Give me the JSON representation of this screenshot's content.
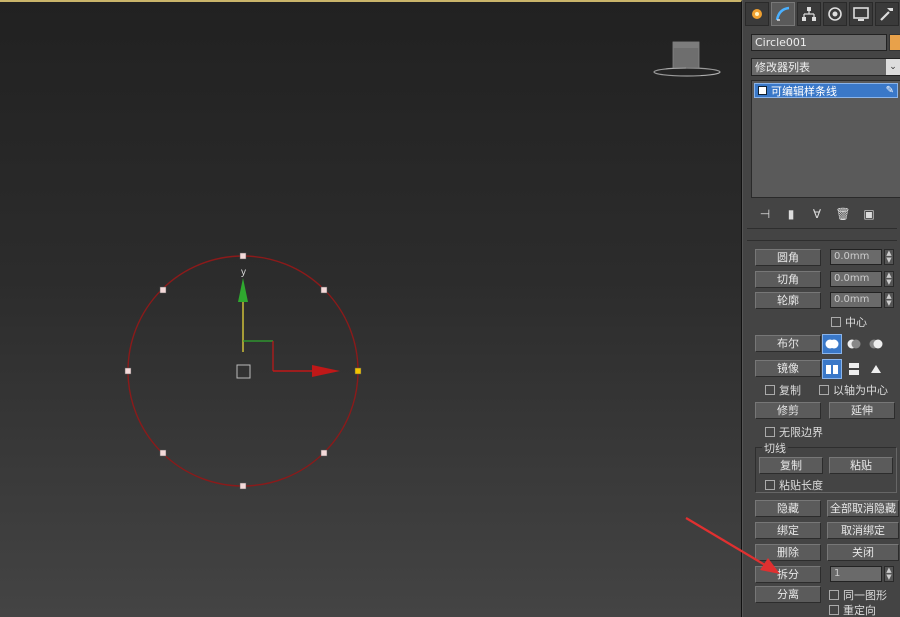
{
  "viewport": {
    "axis_y_label": "y",
    "colors": {
      "spline": "#8b1a1a",
      "axis_x": "#c01818",
      "axis_y": "#2fa82f",
      "annotation_arrow": "#e03030"
    }
  },
  "panel": {
    "tabs": [
      {
        "icon": "create-icon",
        "active": false
      },
      {
        "icon": "modify-icon",
        "active": true
      },
      {
        "icon": "hierarchy-icon",
        "active": false
      },
      {
        "icon": "motion-icon",
        "active": false
      },
      {
        "icon": "display-icon",
        "active": false
      },
      {
        "icon": "utilities-icon",
        "active": false
      }
    ],
    "object_name": "Circle001",
    "object_color": "#e8a14a",
    "modifier_list": "修改器列表",
    "stack_item": "可编辑样条线",
    "geometry": {
      "fillet_label": "圆角",
      "fillet_value": "0.0mm",
      "chamfer_label": "切角",
      "chamfer_value": "0.0mm",
      "outline_label": "轮廓",
      "outline_value": "0.0mm",
      "center_label": "中心",
      "boolean_label": "布尔",
      "mirror_label": "镜像",
      "copy_label": "复制",
      "about_pivot_label": "以轴为中心",
      "trim_label": "修剪",
      "extend_label": "延伸",
      "infinite_bounds_label": "无限边界",
      "tangent_group_label": "切线",
      "tangent_copy_label": "复制",
      "tangent_paste_label": "粘贴",
      "paste_length_label": "粘贴长度",
      "hide_label": "隐藏",
      "unhide_all_label": "全部取消隐藏",
      "bind_label": "绑定",
      "unbind_label": "取消绑定",
      "delete_label": "删除",
      "close_label": "关闭",
      "divide_label": "拆分",
      "divide_value": "1",
      "detach_label": "分离",
      "same_shape_label": "同一图形",
      "reorient_label": "重定向"
    }
  }
}
